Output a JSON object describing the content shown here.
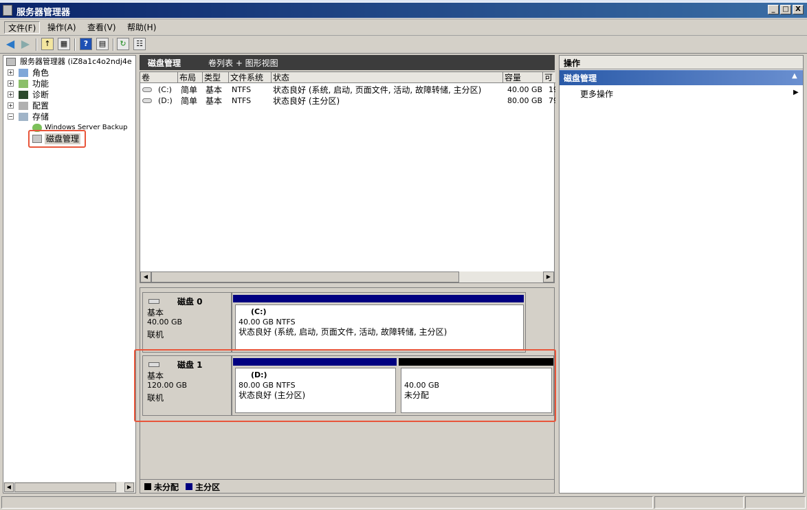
{
  "window": {
    "title": "服务器管理器",
    "min": "_",
    "max": "□",
    "close": "X"
  },
  "menu": [
    "文件(F)",
    "操作(A)",
    "查看(V)",
    "帮助(H)"
  ],
  "tree": {
    "root": "服务器管理器 (iZ8a1c4o2ndj4e",
    "items": [
      "角色",
      "功能",
      "诊断",
      "配置",
      "存储"
    ],
    "storage_children": [
      "Windows Server Backup",
      "磁盘管理"
    ]
  },
  "center": {
    "title": "磁盘管理",
    "subtitle": "卷列表 + 图形视图",
    "columns": [
      "卷",
      "布局",
      "类型",
      "文件系统",
      "状态",
      "容量",
      "可"
    ],
    "rows": [
      {
        "vol": "(C:)",
        "layout": "简单",
        "type": "基本",
        "fs": "NTFS",
        "status": "状态良好 (系统, 启动, 页面文件, 活动, 故障转储, 主分区)",
        "cap": "40.00 GB",
        "free": "19"
      },
      {
        "vol": "(D:)",
        "layout": "简单",
        "type": "基本",
        "fs": "NTFS",
        "status": "状态良好 (主分区)",
        "cap": "80.00 GB",
        "free": "79"
      }
    ]
  },
  "disks": [
    {
      "name": "磁盘 0",
      "type": "基本",
      "size": "40.00 GB",
      "state": "联机",
      "partitions": [
        {
          "label": "(C:)",
          "size": "40.00 GB NTFS",
          "status": "状态良好 (系统, 启动, 页面文件, 活动, 故障转储, 主分区)",
          "color": "#000080"
        }
      ]
    },
    {
      "name": "磁盘 1",
      "type": "基本",
      "size": "120.00 GB",
      "state": "联机",
      "partitions": [
        {
          "label": "(D:)",
          "size": "80.00 GB NTFS",
          "status": "状态良好 (主分区)",
          "color": "#000080"
        },
        {
          "label": "",
          "size": "40.00 GB",
          "status": "未分配",
          "color": "#000000"
        }
      ]
    }
  ],
  "legend": {
    "unallocated": "未分配",
    "primary": "主分区",
    "unallocated_color": "#000000",
    "primary_color": "#000080"
  },
  "actions": {
    "header": "操作",
    "section": "磁盘管理",
    "more": "更多操作"
  },
  "icons": [
    "back-arrow-icon",
    "forward-arrow-icon",
    "folder-up-icon",
    "console-icon",
    "help-icon",
    "properties-icon",
    "refresh-icon",
    "export-icon"
  ]
}
